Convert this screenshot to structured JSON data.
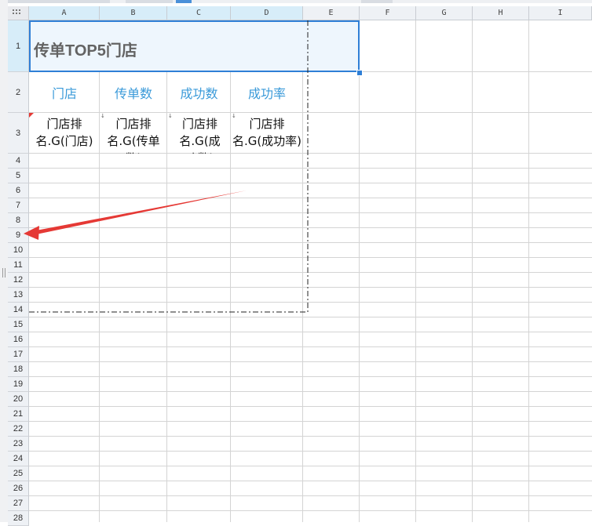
{
  "columns": [
    "A",
    "B",
    "C",
    "D",
    "E",
    "F",
    "G",
    "H",
    "I"
  ],
  "rows": [
    "1",
    "2",
    "3",
    "4",
    "5",
    "6",
    "7",
    "8",
    "9",
    "10",
    "11",
    "12",
    "13",
    "14",
    "15",
    "16",
    "17",
    "18",
    "19",
    "20",
    "21",
    "22",
    "23",
    "24",
    "25",
    "26",
    "27",
    "28"
  ],
  "report": {
    "title": "传单TOP5门店",
    "headers": [
      "门店",
      "传单数",
      "成功数",
      "成功率"
    ],
    "cells": [
      "门店排名.G(门店)",
      "门店排名.G(传单数)",
      "门店排名.G(成功数)",
      "门店排名.G(成功率)"
    ]
  },
  "colors": {
    "selection_border": "#2f7fd6",
    "header_text": "#3a9ad9",
    "title_text": "#636363",
    "annotation_arrow": "#e53935"
  },
  "icons": [
    "select-all-icon",
    "expand-down-icon",
    "comment-marker-icon",
    "annotation-arrow-icon"
  ]
}
